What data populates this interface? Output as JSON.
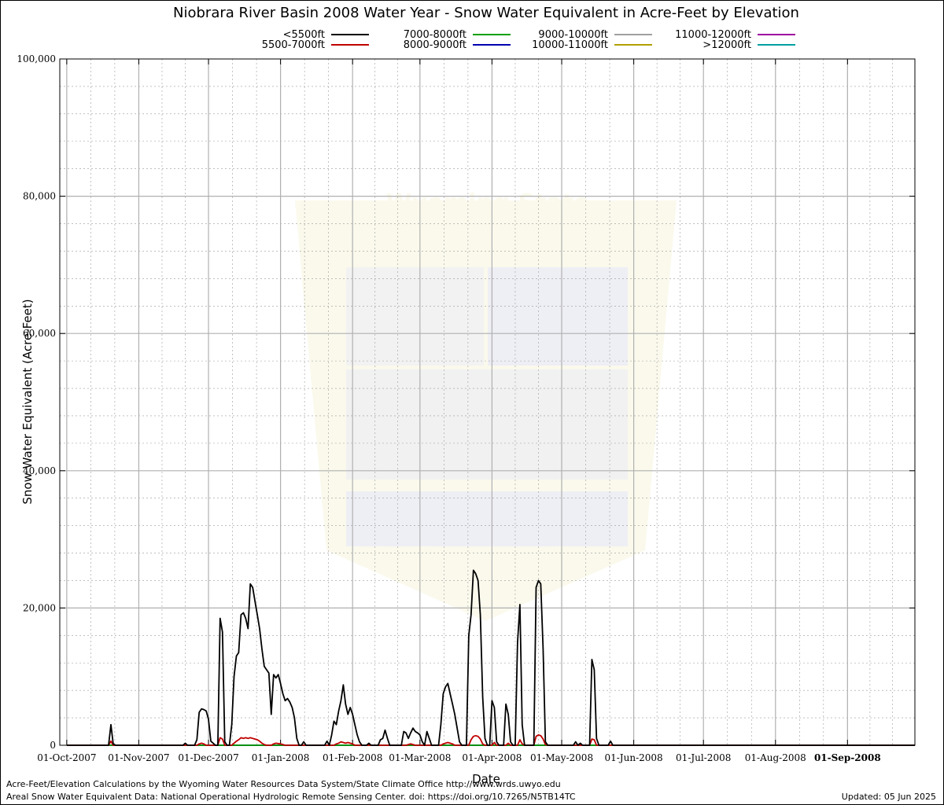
{
  "chart_data": {
    "type": "line",
    "title": "Niobrara River Basin 2008 Water Year - Snow Water Equivalent in Acre-Feet by Elevation",
    "xlabel": "Date",
    "ylabel": "Snow Water Equivalent (Acre-Feet)",
    "ylim": [
      0,
      100000
    ],
    "xlim": [
      "2007-09-28",
      "2008-09-30"
    ],
    "grid": true,
    "legend_position": "top",
    "x_ticks": [
      "2007-10-01",
      "2007-11-01",
      "2007-12-01",
      "2008-01-01",
      "2008-02-01",
      "2008-03-01",
      "2008-04-01",
      "2008-05-01",
      "2008-06-01",
      "2008-07-01",
      "2008-08-01",
      "2008-09-01"
    ],
    "x_tick_labels": [
      "01-Oct-2007",
      "01-Nov-2007",
      "01-Dec-2007",
      "01-Jan-2008",
      "01-Feb-2008",
      "01-Mar-2008",
      "01-Apr-2008",
      "01-May-2008",
      "01-Jun-2008",
      "01-Jul-2008",
      "01-Aug-2008",
      "01-Sep-2008"
    ],
    "y_ticks": [
      0,
      20000,
      40000,
      60000,
      80000,
      100000
    ],
    "y_tick_labels": [
      "0",
      "20,000",
      "40,000",
      "60,000",
      "80,000",
      "100,000"
    ],
    "series": [
      {
        "name": "<5500ft",
        "color": "#000000",
        "points": [
          [
            "2007-10-01",
            0
          ],
          [
            "2007-10-19",
            0
          ],
          [
            "2007-10-20",
            3000
          ],
          [
            "2007-10-21",
            200
          ],
          [
            "2007-10-22",
            0
          ],
          [
            "2007-11-20",
            0
          ],
          [
            "2007-11-21",
            300
          ],
          [
            "2007-11-22",
            0
          ],
          [
            "2007-11-25",
            0
          ],
          [
            "2007-11-26",
            800
          ],
          [
            "2007-11-27",
            4800
          ],
          [
            "2007-11-28",
            5300
          ],
          [
            "2007-11-29",
            5200
          ],
          [
            "2007-11-30",
            5000
          ],
          [
            "2007-12-01",
            3800
          ],
          [
            "2007-12-02",
            600
          ],
          [
            "2007-12-03",
            300
          ],
          [
            "2007-12-04",
            0
          ],
          [
            "2007-12-05",
            0
          ],
          [
            "2007-12-06",
            18500
          ],
          [
            "2007-12-07",
            16500
          ],
          [
            "2007-12-08",
            500
          ],
          [
            "2007-12-09",
            0
          ],
          [
            "2007-12-10",
            0
          ],
          [
            "2007-12-11",
            3000
          ],
          [
            "2007-12-12",
            10000
          ],
          [
            "2007-12-13",
            13000
          ],
          [
            "2007-12-14",
            13500
          ],
          [
            "2007-12-15",
            19000
          ],
          [
            "2007-12-16",
            19300
          ],
          [
            "2007-12-17",
            18500
          ],
          [
            "2007-12-18",
            17000
          ],
          [
            "2007-12-19",
            23500
          ],
          [
            "2007-12-20",
            23000
          ],
          [
            "2007-12-21",
            21000
          ],
          [
            "2007-12-22",
            19000
          ],
          [
            "2007-12-23",
            17000
          ],
          [
            "2007-12-24",
            14000
          ],
          [
            "2007-12-25",
            11500
          ],
          [
            "2007-12-26",
            11000
          ],
          [
            "2007-12-27",
            10500
          ],
          [
            "2007-12-28",
            4500
          ],
          [
            "2007-12-29",
            10300
          ],
          [
            "2007-12-30",
            9800
          ],
          [
            "2007-12-31",
            10300
          ],
          [
            "2008-01-01",
            9000
          ],
          [
            "2008-01-02",
            7500
          ],
          [
            "2008-01-03",
            6500
          ],
          [
            "2008-01-04",
            6800
          ],
          [
            "2008-01-05",
            6300
          ],
          [
            "2008-01-06",
            5500
          ],
          [
            "2008-01-07",
            4000
          ],
          [
            "2008-01-08",
            1000
          ],
          [
            "2008-01-09",
            0
          ],
          [
            "2008-01-10",
            0
          ],
          [
            "2008-01-11",
            500
          ],
          [
            "2008-01-12",
            0
          ],
          [
            "2008-01-20",
            0
          ],
          [
            "2008-01-21",
            600
          ],
          [
            "2008-01-22",
            0
          ],
          [
            "2008-01-23",
            1500
          ],
          [
            "2008-01-24",
            3500
          ],
          [
            "2008-01-25",
            3000
          ],
          [
            "2008-01-26",
            5000
          ],
          [
            "2008-01-27",
            6500
          ],
          [
            "2008-01-28",
            8800
          ],
          [
            "2008-01-29",
            6000
          ],
          [
            "2008-01-30",
            4500
          ],
          [
            "2008-01-31",
            5500
          ],
          [
            "2008-02-01",
            4500
          ],
          [
            "2008-02-02",
            3000
          ],
          [
            "2008-02-03",
            1500
          ],
          [
            "2008-02-04",
            500
          ],
          [
            "2008-02-05",
            0
          ],
          [
            "2008-02-07",
            0
          ],
          [
            "2008-02-08",
            300
          ],
          [
            "2008-02-09",
            0
          ],
          [
            "2008-02-12",
            0
          ],
          [
            "2008-02-13",
            800
          ],
          [
            "2008-02-14",
            1000
          ],
          [
            "2008-02-15",
            2200
          ],
          [
            "2008-02-16",
            1000
          ],
          [
            "2008-02-17",
            0
          ],
          [
            "2008-02-22",
            0
          ],
          [
            "2008-02-23",
            2000
          ],
          [
            "2008-02-24",
            1800
          ],
          [
            "2008-02-25",
            1000
          ],
          [
            "2008-02-26",
            1800
          ],
          [
            "2008-02-27",
            2500
          ],
          [
            "2008-02-28",
            2000
          ],
          [
            "2008-02-29",
            1800
          ],
          [
            "2008-03-01",
            1500
          ],
          [
            "2008-03-02",
            500
          ],
          [
            "2008-03-03",
            0
          ],
          [
            "2008-03-04",
            2000
          ],
          [
            "2008-03-05",
            1000
          ],
          [
            "2008-03-06",
            0
          ],
          [
            "2008-03-09",
            0
          ],
          [
            "2008-03-10",
            3000
          ],
          [
            "2008-03-11",
            7500
          ],
          [
            "2008-03-12",
            8500
          ],
          [
            "2008-03-13",
            9000
          ],
          [
            "2008-03-14",
            7500
          ],
          [
            "2008-03-15",
            6000
          ],
          [
            "2008-03-16",
            4500
          ],
          [
            "2008-03-17",
            2500
          ],
          [
            "2008-03-18",
            500
          ],
          [
            "2008-03-19",
            0
          ],
          [
            "2008-03-21",
            0
          ],
          [
            "2008-03-22",
            16000
          ],
          [
            "2008-03-23",
            19000
          ],
          [
            "2008-03-24",
            25500
          ],
          [
            "2008-03-25",
            25000
          ],
          [
            "2008-03-26",
            24000
          ],
          [
            "2008-03-27",
            19000
          ],
          [
            "2008-03-28",
            7000
          ],
          [
            "2008-03-29",
            1000
          ],
          [
            "2008-03-30",
            0
          ],
          [
            "2008-03-31",
            0
          ],
          [
            "2008-04-01",
            6500
          ],
          [
            "2008-04-02",
            5500
          ],
          [
            "2008-04-03",
            500
          ],
          [
            "2008-04-04",
            0
          ],
          [
            "2008-04-06",
            0
          ],
          [
            "2008-04-07",
            6000
          ],
          [
            "2008-04-08",
            4500
          ],
          [
            "2008-04-09",
            500
          ],
          [
            "2008-04-10",
            0
          ],
          [
            "2008-04-11",
            0
          ],
          [
            "2008-04-12",
            15000
          ],
          [
            "2008-04-13",
            20500
          ],
          [
            "2008-04-14",
            3000
          ],
          [
            "2008-04-15",
            0
          ],
          [
            "2008-04-19",
            0
          ],
          [
            "2008-04-20",
            23000
          ],
          [
            "2008-04-21",
            24000
          ],
          [
            "2008-04-22",
            23500
          ],
          [
            "2008-04-23",
            14000
          ],
          [
            "2008-04-24",
            500
          ],
          [
            "2008-04-25",
            0
          ],
          [
            "2008-05-06",
            0
          ],
          [
            "2008-05-07",
            500
          ],
          [
            "2008-05-08",
            0
          ],
          [
            "2008-05-09",
            300
          ],
          [
            "2008-05-10",
            0
          ],
          [
            "2008-05-13",
            0
          ],
          [
            "2008-05-14",
            12500
          ],
          [
            "2008-05-15",
            11000
          ],
          [
            "2008-05-16",
            1000
          ],
          [
            "2008-05-17",
            0
          ],
          [
            "2008-05-21",
            0
          ],
          [
            "2008-05-22",
            600
          ],
          [
            "2008-05-23",
            0
          ],
          [
            "2008-09-30",
            0
          ]
        ]
      },
      {
        "name": "5500-7000ft",
        "color": "#c00000",
        "points": [
          [
            "2007-10-01",
            0
          ],
          [
            "2007-10-19",
            0
          ],
          [
            "2007-10-20",
            600
          ],
          [
            "2007-10-21",
            0
          ],
          [
            "2007-11-26",
            0
          ],
          [
            "2007-11-27",
            200
          ],
          [
            "2007-11-28",
            300
          ],
          [
            "2007-11-29",
            200
          ],
          [
            "2007-11-30",
            0
          ],
          [
            "2007-12-05",
            0
          ],
          [
            "2007-12-06",
            1100
          ],
          [
            "2007-12-07",
            900
          ],
          [
            "2007-12-08",
            0
          ],
          [
            "2007-12-11",
            0
          ],
          [
            "2007-12-12",
            300
          ],
          [
            "2007-12-13",
            600
          ],
          [
            "2007-12-14",
            800
          ],
          [
            "2007-12-15",
            1100
          ],
          [
            "2007-12-16",
            1000
          ],
          [
            "2007-12-17",
            1100
          ],
          [
            "2007-12-18",
            1000
          ],
          [
            "2007-12-19",
            1100
          ],
          [
            "2007-12-20",
            1000
          ],
          [
            "2007-12-21",
            900
          ],
          [
            "2007-12-22",
            800
          ],
          [
            "2007-12-23",
            600
          ],
          [
            "2007-12-24",
            300
          ],
          [
            "2007-12-25",
            100
          ],
          [
            "2007-12-26",
            0
          ],
          [
            "2007-12-28",
            0
          ],
          [
            "2007-12-29",
            200
          ],
          [
            "2007-12-30",
            300
          ],
          [
            "2008-01-01",
            200
          ],
          [
            "2008-01-02",
            100
          ],
          [
            "2008-01-03",
            0
          ],
          [
            "2008-01-24",
            0
          ],
          [
            "2008-01-25",
            200
          ],
          [
            "2008-01-26",
            300
          ],
          [
            "2008-01-27",
            500
          ],
          [
            "2008-01-28",
            400
          ],
          [
            "2008-01-29",
            300
          ],
          [
            "2008-01-30",
            400
          ],
          [
            "2008-01-31",
            300
          ],
          [
            "2008-02-01",
            200
          ],
          [
            "2008-02-02",
            0
          ],
          [
            "2008-02-24",
            0
          ],
          [
            "2008-02-25",
            100
          ],
          [
            "2008-02-26",
            200
          ],
          [
            "2008-02-27",
            100
          ],
          [
            "2008-02-28",
            0
          ],
          [
            "2008-03-10",
            0
          ],
          [
            "2008-03-11",
            200
          ],
          [
            "2008-03-12",
            300
          ],
          [
            "2008-03-13",
            400
          ],
          [
            "2008-03-14",
            300
          ],
          [
            "2008-03-15",
            200
          ],
          [
            "2008-03-16",
            0
          ],
          [
            "2008-03-22",
            0
          ],
          [
            "2008-03-23",
            800
          ],
          [
            "2008-03-24",
            1300
          ],
          [
            "2008-03-25",
            1400
          ],
          [
            "2008-03-26",
            1300
          ],
          [
            "2008-03-27",
            900
          ],
          [
            "2008-03-28",
            200
          ],
          [
            "2008-03-29",
            0
          ],
          [
            "2008-04-01",
            0
          ],
          [
            "2008-04-02",
            400
          ],
          [
            "2008-04-03",
            0
          ],
          [
            "2008-04-07",
            0
          ],
          [
            "2008-04-08",
            300
          ],
          [
            "2008-04-09",
            0
          ],
          [
            "2008-04-12",
            0
          ],
          [
            "2008-04-13",
            800
          ],
          [
            "2008-04-14",
            200
          ],
          [
            "2008-04-15",
            0
          ],
          [
            "2008-04-19",
            0
          ],
          [
            "2008-04-20",
            1300
          ],
          [
            "2008-04-21",
            1500
          ],
          [
            "2008-04-22",
            1400
          ],
          [
            "2008-04-23",
            900
          ],
          [
            "2008-04-24",
            100
          ],
          [
            "2008-04-25",
            0
          ],
          [
            "2008-05-13",
            0
          ],
          [
            "2008-05-14",
            900
          ],
          [
            "2008-05-15",
            800
          ],
          [
            "2008-05-16",
            0
          ],
          [
            "2008-09-30",
            0
          ]
        ]
      },
      {
        "name": "7000-8000ft",
        "color": "#00a000",
        "points": [
          [
            "2007-10-01",
            0
          ],
          [
            "2008-09-30",
            0
          ]
        ]
      },
      {
        "name": "8000-9000ft",
        "color": "#0000b0",
        "points": [
          [
            "2007-10-01",
            0
          ],
          [
            "2008-09-30",
            0
          ]
        ]
      },
      {
        "name": "9000-10000ft",
        "color": "#a0a0a0",
        "points": [
          [
            "2007-10-01",
            0
          ],
          [
            "2008-09-30",
            0
          ]
        ]
      },
      {
        "name": "10000-11000ft",
        "color": "#b0a000",
        "points": [
          [
            "2007-10-01",
            0
          ],
          [
            "2008-09-30",
            0
          ]
        ]
      },
      {
        "name": "11000-12000ft",
        "color": "#a000a0",
        "points": [
          [
            "2007-10-01",
            0
          ],
          [
            "2008-09-30",
            0
          ]
        ]
      },
      {
        "name": ">12000ft",
        "color": "#00a0a0",
        "points": [
          [
            "2007-10-01",
            0
          ],
          [
            "2008-09-30",
            0
          ]
        ]
      }
    ]
  },
  "footer": {
    "credit_line1": "Acre-Feet/Elevation Calculations by the Wyoming Water Resources Data System/State Climate Office http://www.wrds.uwyo.edu",
    "credit_line2": "Areal Snow Water Equivalent Data: National Operational Hydrologic Remote Sensing Center. doi: https://doi.org/10.7265/N5TB14TC",
    "updated": "Updated: 05 Jun 2025"
  },
  "watermark": {
    "text_line1": "Wyoming State",
    "text_line2": "Climate Office"
  }
}
